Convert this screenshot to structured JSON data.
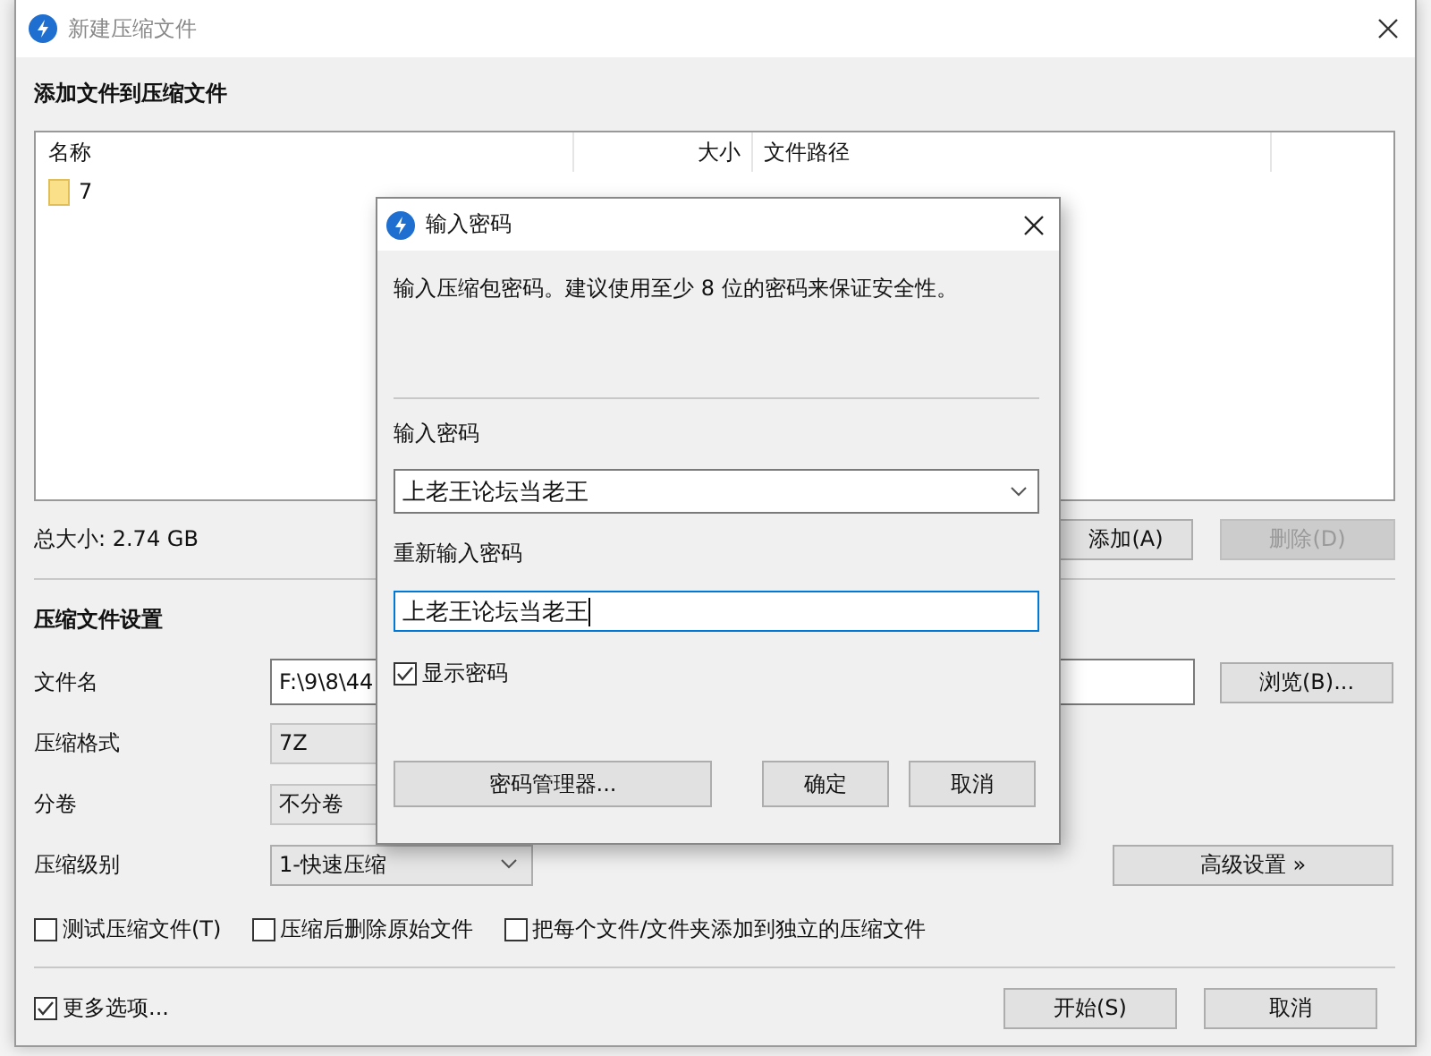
{
  "window": {
    "title": "新建压缩文件"
  },
  "files_section": {
    "heading": "添加文件到压缩文件",
    "columns": [
      "名称",
      "大小",
      "文件路径"
    ],
    "rows": [
      {
        "name": "7"
      }
    ],
    "total": "总大小: 2.74 GB",
    "buttons": [
      {
        "label": "添加(A)",
        "disabled": false
      },
      {
        "label": "删除(D)",
        "disabled": true
      }
    ]
  },
  "settings": {
    "heading": "压缩文件设置",
    "fields": [
      {
        "label": "文件名",
        "kind": "text",
        "value": "F:\\9\\8\\44",
        "button": "浏览(B)..."
      },
      {
        "label": "压缩格式",
        "kind": "locked",
        "value": "7Z"
      },
      {
        "label": "分卷",
        "kind": "locked",
        "value": "不分卷"
      },
      {
        "label": "压缩级别",
        "kind": "dropdown",
        "value": "1-快速压缩",
        "button": "高级设置 »"
      }
    ],
    "options": [
      {
        "label": "测试压缩文件(T)",
        "checked": false
      },
      {
        "label": "压缩后删除原始文件",
        "checked": false
      },
      {
        "label": "把每个文件/文件夹添加到独立的压缩文件",
        "checked": false
      }
    ]
  },
  "footer": {
    "more": {
      "label": "更多选项...",
      "checked": true
    },
    "buttons": [
      "开始(S)",
      "取消"
    ]
  },
  "dialog": {
    "title": "输入密码",
    "message": "输入压缩包密码。建议使用至少 8 位的密码来保证安全性。",
    "password_label": "输入密码",
    "password": "上老王论坛当老王",
    "confirm_label": "重新输入密码",
    "confirm": "上老王论坛当老王",
    "show_password": {
      "label": "显示密码",
      "checked": true
    },
    "buttons": [
      {
        "label": "密码管理器...",
        "kind": "wide"
      },
      {
        "label": "确定",
        "kind": "normal"
      },
      {
        "label": "取消",
        "kind": "normal"
      }
    ]
  }
}
